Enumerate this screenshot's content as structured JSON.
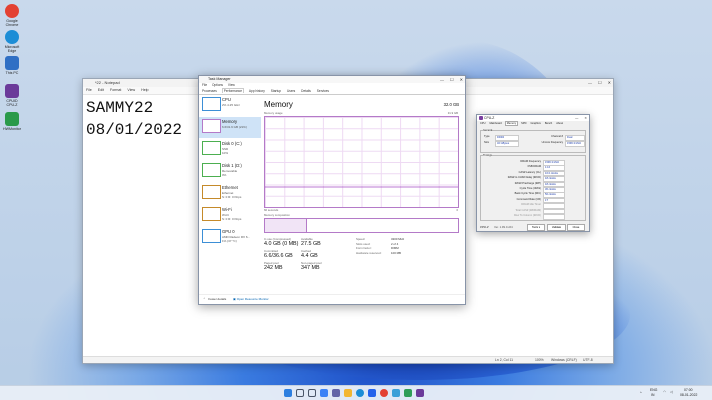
{
  "desktop": {
    "icons": [
      {
        "label": "Google Chrome",
        "color": "#e34133"
      },
      {
        "label": "Microsoft Edge",
        "color": "#1c8dd6"
      },
      {
        "label": "This PC",
        "color": "#2f6fc4"
      },
      {
        "label": "CPUID CPU-Z",
        "color": "#6b3a9a"
      },
      {
        "label": "HWMonitor",
        "color": "#2a9a4a"
      }
    ]
  },
  "notepad": {
    "title": "*22 - Notepad",
    "menu": [
      "File",
      "Edit",
      "Format",
      "View",
      "Help"
    ],
    "text_line1": "SAMMY22",
    "text_line2": "08/01/2022",
    "status": {
      "position": "Ln 2, Col 11",
      "zoom": "100%",
      "eol": "Windows (CRLF)",
      "encoding": "UTF-8"
    }
  },
  "taskmanager": {
    "title": "Task Manager",
    "menu": [
      "File",
      "Options",
      "View"
    ],
    "tabs": [
      "Processes",
      "Performance",
      "App history",
      "Startup",
      "Users",
      "Details",
      "Services"
    ],
    "active_tab": "Performance",
    "sidebar": [
      {
        "name": "CPU",
        "sub1": "2%  4.25 GHz",
        "sub2": ""
      },
      {
        "name": "Memory",
        "sub1": "6.6/31.9 GB (21%)",
        "sub2": ""
      },
      {
        "name": "Disk 0 (C:)",
        "sub1": "SSD",
        "sub2": "10%"
      },
      {
        "name": "Disk 1 (D:)",
        "sub1": "Removable",
        "sub2": "0%"
      },
      {
        "name": "Ethernet",
        "sub1": "Ethernet",
        "sub2": "S: 0 R: 0 Kbps"
      },
      {
        "name": "Wi-Fi",
        "sub1": "Wi-Fi",
        "sub2": "S: 0 R: 0 Kbps"
      },
      {
        "name": "GPU 0",
        "sub1": "AMD Radeon RX 6...",
        "sub2": "1% (37 °C)"
      }
    ],
    "memory": {
      "heading": "Memory",
      "capacity": "32.0 GB",
      "graph_label": "Memory usage",
      "graph_max": "31.9 GB",
      "graph_time": "60 seconds",
      "graph_min": "0",
      "composition_label": "Memory composition",
      "composition_fraction": 0.21,
      "stats": {
        "in_use_label": "In use (Compressed)",
        "in_use": "4.0 GB (0 MB)",
        "available_label": "Available",
        "available": "27.5 GB",
        "committed_label": "Committed",
        "committed": "6.6/36.6 GB",
        "cached_label": "Cached",
        "cached": "4.4 GB",
        "paged_label": "Paged pool",
        "paged": "242 MB",
        "nonpaged_label": "Non-paged pool",
        "nonpaged": "347 MB"
      },
      "right_stats": [
        {
          "label": "Speed:",
          "value": "3200 MHz"
        },
        {
          "label": "Slots used:",
          "value": "2 of 4"
        },
        {
          "label": "Form factor:",
          "value": "DIMM"
        },
        {
          "label": "Hardware reserved:",
          "value": "100 MB"
        }
      ]
    },
    "footer": {
      "fewer": "Fewer details",
      "monitor": "Open Resource Monitor"
    }
  },
  "cpuz": {
    "title": "CPU-Z",
    "tabs": [
      "CPU",
      "Mainboard",
      "Memory",
      "SPD",
      "Graphics",
      "Bench",
      "About"
    ],
    "active_tab": "Memory",
    "general_label": "General",
    "type_label": "Type",
    "type": "DDR4",
    "size_label": "Size",
    "size": "32 GBytes",
    "channel_label": "Channel #",
    "channel": "Dual",
    "uncore_label": "Uncore Frequency",
    "uncore": "1596.3 MHz",
    "timings_label": "Timings",
    "timings": [
      {
        "label": "DRAM Frequency",
        "value": "1596.3 MHz"
      },
      {
        "label": "FSB:DRAM",
        "value": "1:16"
      },
      {
        "label": "CAS# Latency (CL)",
        "value": "16.0 clocks"
      },
      {
        "label": "RAS# to CAS# Delay (tRCD)",
        "value": "18 clocks"
      },
      {
        "label": "RAS# Precharge (tRP)",
        "value": "18 clocks"
      },
      {
        "label": "Cycle Time (tRAS)",
        "value": "36 clocks"
      },
      {
        "label": "Bank Cycle Time (tRC)",
        "value": "56 clocks"
      },
      {
        "label": "Command Rate (CR)",
        "value": "1T"
      },
      {
        "label": "DRAM Idle Timer",
        "value": ""
      },
      {
        "label": "Total CAS# (tRDRAM)",
        "value": ""
      },
      {
        "label": "Row To Column (tRCD)",
        "value": ""
      }
    ],
    "version": "Ver. 1.99.0.x64",
    "tools_label": "Tools",
    "validate_label": "Validate",
    "close_label": "Close"
  },
  "taskbar": {
    "icons": [
      {
        "name": "start",
        "color": "#2d7fe0"
      },
      {
        "name": "search",
        "color": "#4a5568"
      },
      {
        "name": "task-view",
        "color": "#4a5568"
      },
      {
        "name": "widgets",
        "color": "#3b82f6"
      },
      {
        "name": "chat",
        "color": "#6264a7"
      },
      {
        "name": "file-explorer",
        "color": "#f2b632"
      },
      {
        "name": "edge",
        "color": "#1c8dd6"
      },
      {
        "name": "store",
        "color": "#2563eb"
      },
      {
        "name": "chrome",
        "color": "#e34133"
      },
      {
        "name": "notepad",
        "color": "#3aa0d8"
      },
      {
        "name": "task-manager",
        "color": "#2f9e58"
      },
      {
        "name": "cpu-z",
        "color": "#6b3a9a"
      }
    ],
    "lang": "ENG",
    "region": "IN",
    "time": "07:00",
    "date": "08-01-2022"
  }
}
